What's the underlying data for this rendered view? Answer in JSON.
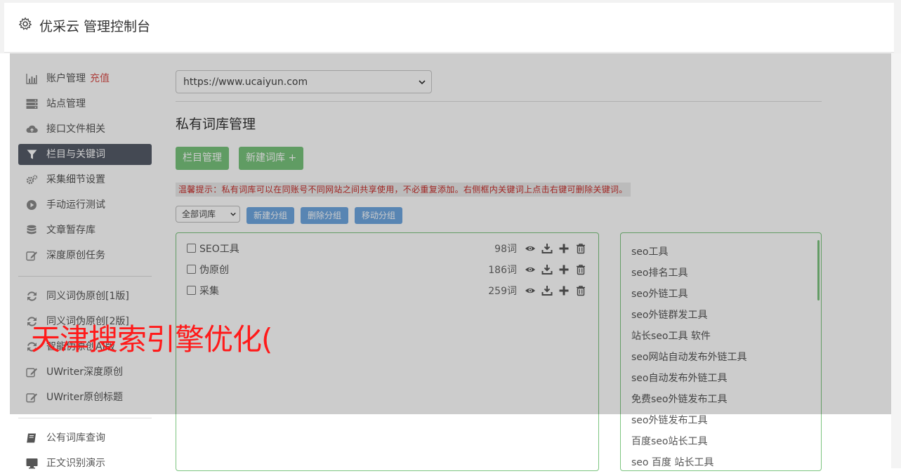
{
  "header": {
    "title": "优采云 管理控制台",
    "icon": "gear-icon"
  },
  "sidebar": {
    "group1": [
      {
        "label": "账户管理",
        "badge": "充值",
        "icon": "bar-chart-icon"
      },
      {
        "label": "站点管理",
        "icon": "server-icon"
      },
      {
        "label": "接口文件相关",
        "icon": "cloud-upload-icon"
      },
      {
        "label": "栏目与关键词",
        "icon": "filter-icon",
        "active": true
      },
      {
        "label": "采集细节设置",
        "icon": "cogs-icon"
      },
      {
        "label": "手动运行测试",
        "icon": "play-circle-icon"
      },
      {
        "label": "文章暂存库",
        "icon": "database-icon"
      },
      {
        "label": "深度原创任务",
        "icon": "edit-icon"
      }
    ],
    "group2": [
      {
        "label": "同义词伪原创[1版]",
        "icon": "refresh-icon"
      },
      {
        "label": "同义词伪原创[2版]",
        "icon": "refresh-icon"
      },
      {
        "label": "智能伪原创AI版",
        "icon": "refresh-icon"
      },
      {
        "label": "UWriter深度原创",
        "icon": "edit-icon"
      },
      {
        "label": "UWriter原创标题",
        "icon": "edit-icon"
      }
    ],
    "group3": [
      {
        "label": "公有词库查询",
        "icon": "book-icon"
      },
      {
        "label": "正文识别演示",
        "icon": "monitor-icon"
      }
    ]
  },
  "main": {
    "site_select": {
      "value": "https://www.ucaiyun.com"
    },
    "title": "私有词库管理",
    "buttons": {
      "columns": "栏目管理",
      "new_library": "新建词库 +"
    },
    "tip": "温馨提示：私有词库可以在同账号不同网站之间共享使用，不必重复添加。右侧框内关键词上点击右键可删除关键词。",
    "group_select": {
      "value": "全部词库"
    },
    "group_buttons": {
      "new_group": "新建分组",
      "delete_group": "删除分组",
      "move_group": "移动分组"
    },
    "libraries": [
      {
        "name": "SEO工具",
        "count": "98词"
      },
      {
        "name": "伪原创",
        "count": "186词"
      },
      {
        "name": "采集",
        "count": "259词"
      }
    ],
    "keywords": [
      "seo工具",
      "seo排名工具",
      "seo外链工具",
      "seo外链群发工具",
      "站长seo工具 软件",
      "seo网站自动发布外链工具",
      "seo自动发布外链工具",
      "免费seo外链发布工具",
      "seo外链发布工具",
      "百度seo站长工具",
      "seo 百度 站长工具"
    ]
  },
  "overlay": {
    "watermark": "天津搜索引擎优化("
  },
  "colors": {
    "accent_green": "#78c47c",
    "accent_blue": "#6fa7e0",
    "active_nav": "#555c68",
    "tip_red": "#c9302c",
    "badge_red": "#d9534f",
    "watermark_red": "#ff1a1a"
  }
}
